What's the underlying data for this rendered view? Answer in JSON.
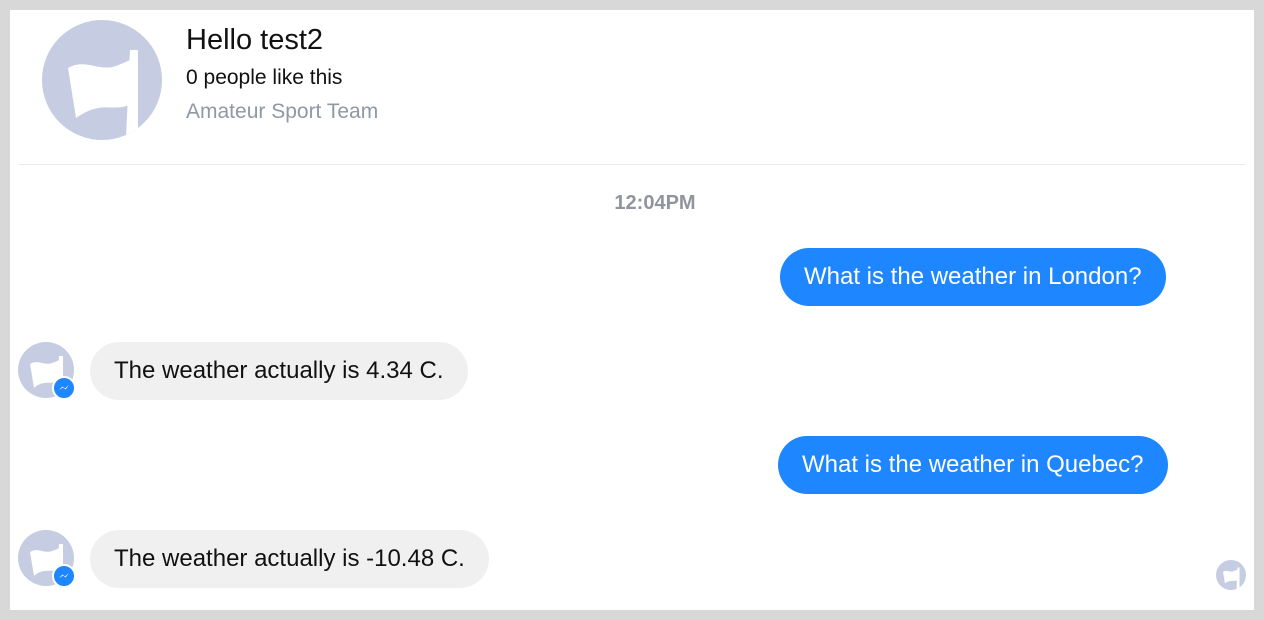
{
  "page": {
    "title": "Hello test2",
    "likes": "0 people like this",
    "category": "Amateur Sport Team"
  },
  "conversation": {
    "timestamp": "12:04PM",
    "messages": [
      {
        "from": "user",
        "text": "What is the weather in London?"
      },
      {
        "from": "bot",
        "text": "The weather actually is 4.34 C."
      },
      {
        "from": "user",
        "text": "What is the weather in Quebec?"
      },
      {
        "from": "bot",
        "text": "The weather actually is -10.48 C."
      }
    ]
  },
  "icons": {
    "page_avatar": "flag-icon",
    "bot_avatar": "flag-icon",
    "bot_badge": "messenger-icon",
    "seen_indicator": "flag-icon"
  },
  "colors": {
    "outgoing_bubble": "#1e86ff",
    "incoming_bubble": "#f0f0f0",
    "avatar_bg": "#c6cde2",
    "muted_text": "#9197a3"
  }
}
